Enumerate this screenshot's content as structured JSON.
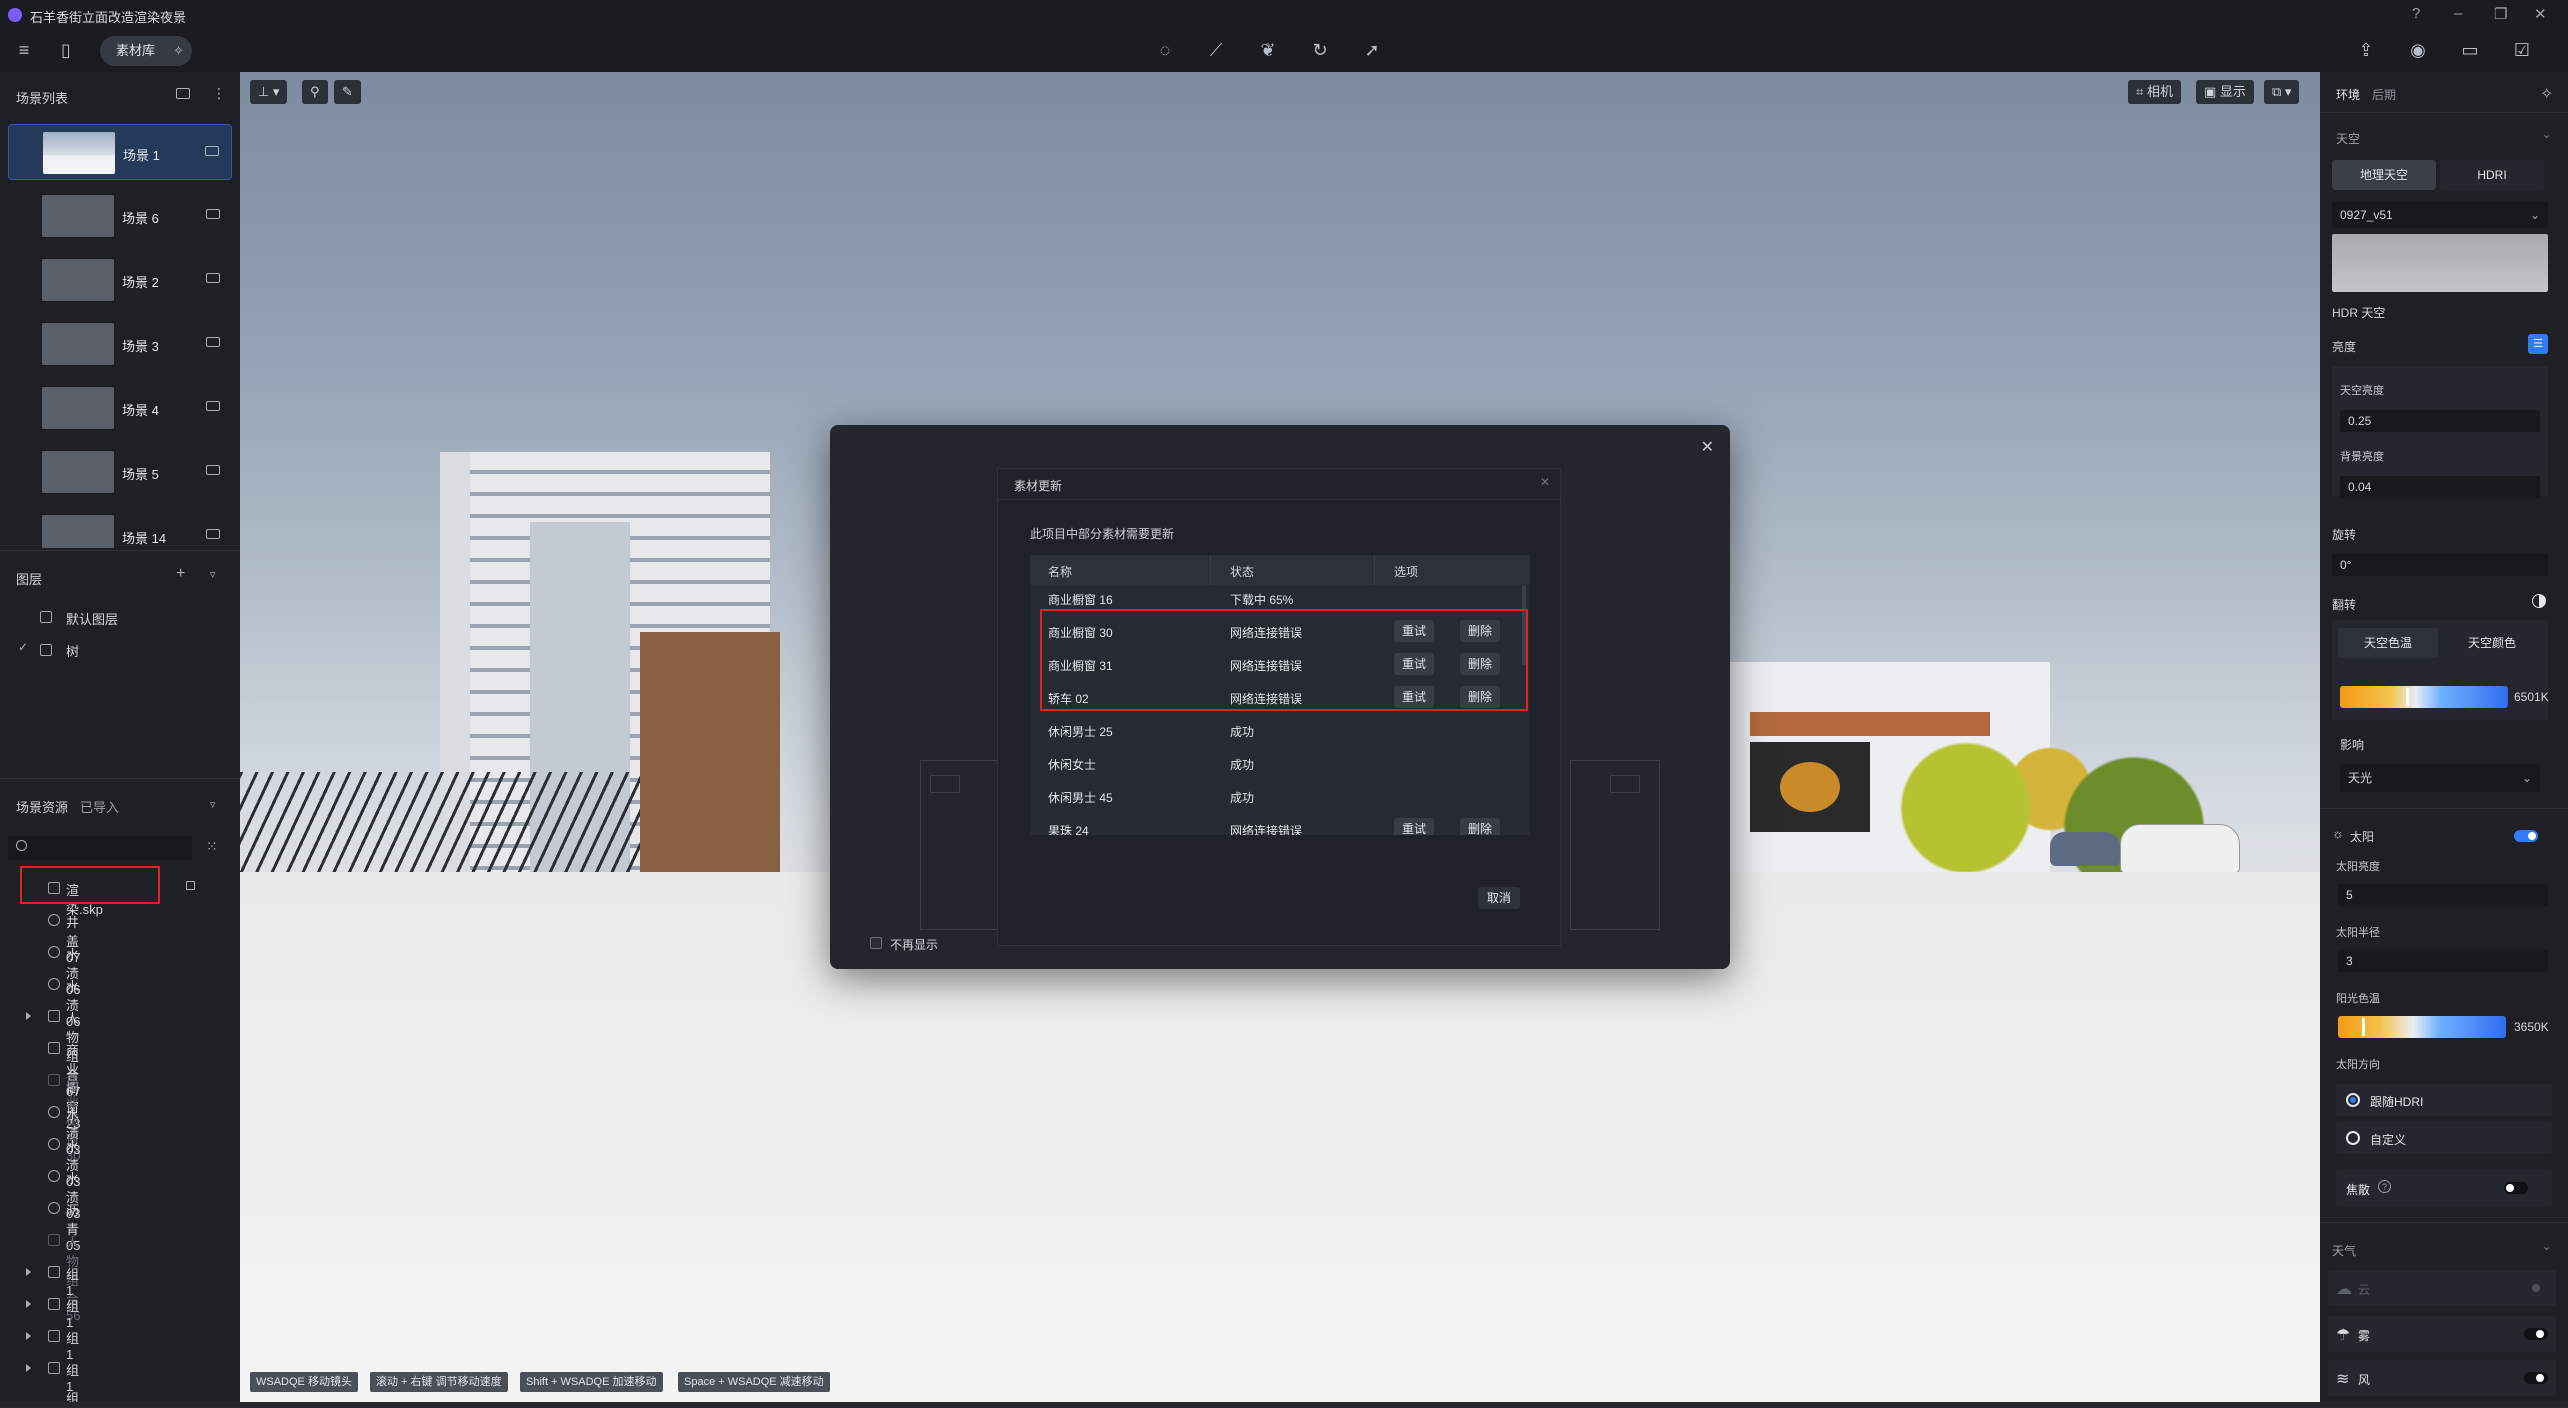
{
  "app": {
    "title": "石羊香街立面改造渲染夜景",
    "material_library": "素材库"
  },
  "left": {
    "scene_list_title": "场景列表",
    "scenes": [
      {
        "label": "场景 1"
      },
      {
        "label": "场景 6"
      },
      {
        "label": "场景 2"
      },
      {
        "label": "场景 3"
      },
      {
        "label": "场景 4"
      },
      {
        "label": "场景 5"
      },
      {
        "label": "场景 14"
      }
    ],
    "layers_title": "图层",
    "layers": [
      {
        "label": "默认图层"
      },
      {
        "label": "树"
      }
    ],
    "resources_tab": "场景资源",
    "imported_tab": "已导入",
    "resources": [
      {
        "label": "渲染.skp"
      },
      {
        "label": "井盖 07"
      },
      {
        "label": "水渍 06"
      },
      {
        "label": "水渍 06"
      },
      {
        "label": "人物组合 67"
      },
      {
        "label": "商业橱窗 23"
      },
      {
        "label": "商业橱窗 30"
      },
      {
        "label": "水渍 03"
      },
      {
        "label": "水渍 03"
      },
      {
        "label": "水渍 03"
      },
      {
        "label": "沥青 05"
      },
      {
        "label": "人物组合 56"
      },
      {
        "label": "组 1"
      },
      {
        "label": "组 1"
      },
      {
        "label": "组 1"
      },
      {
        "label": "组 1"
      },
      {
        "label": "组 1"
      }
    ]
  },
  "viewport": {
    "camera_btn": "相机",
    "display_btn": "显示",
    "hints": [
      {
        "key": "WSADQE",
        "desc": "移动镜头"
      },
      {
        "key": "滚动 + 右键",
        "desc": "调节移动速度"
      },
      {
        "key": "Shift + WSADQE",
        "desc": "加速移动"
      },
      {
        "key": "Space + WSADQE",
        "desc": "减速移动"
      }
    ]
  },
  "dialog": {
    "title": "素材更新",
    "subtitle": "此项目中部分素材需要更新",
    "columns": [
      "名称",
      "状态",
      "选项"
    ],
    "rows": [
      {
        "name": "商业橱窗 16",
        "status": "下载中 65%",
        "retry": "",
        "delete": ""
      },
      {
        "name": "商业橱窗 30",
        "status": "网络连接错误",
        "retry": "重试",
        "delete": "删除"
      },
      {
        "name": "商业橱窗 31",
        "status": "网络连接错误",
        "retry": "重试",
        "delete": "删除"
      },
      {
        "name": "轿车 02",
        "status": "网络连接错误",
        "retry": "重试",
        "delete": "删除"
      },
      {
        "name": "休闲男士 25",
        "status": "成功",
        "retry": "",
        "delete": ""
      },
      {
        "name": "休闲女士",
        "status": "成功",
        "retry": "",
        "delete": ""
      },
      {
        "name": "休闲男士 45",
        "status": "成功",
        "retry": "",
        "delete": ""
      },
      {
        "name": "果珠 24",
        "status": "网络连接错误",
        "retry": "重试",
        "delete": "删除"
      }
    ],
    "cancel": "取消",
    "dont_show": "不再显示"
  },
  "right": {
    "tabs": [
      "环境",
      "后期"
    ],
    "sky_title": "天空",
    "sky_modes": [
      "地理天空",
      "HDRI"
    ],
    "hdri_select": "0927_v51",
    "hdr_sky_label": "HDR 天空",
    "brightness_label": "亮度",
    "sky_brightness_label": "天空亮度",
    "sky_brightness": "0.25",
    "bg_brightness_label": "背景亮度",
    "bg_brightness": "0.04",
    "rotation_label": "旋转",
    "rotation": "0°",
    "flip_label": "翻转",
    "tint_modes": [
      "天空色温",
      "天空颜色"
    ],
    "sky_temp": "6501K",
    "influence_label": "影响",
    "influence_value": "天光",
    "sun_label": "太阳",
    "sun_brightness_label": "太阳亮度",
    "sun_brightness": "5",
    "sun_radius_label": "太阳半径",
    "sun_radius": "3",
    "sun_temp_label": "阳光色温",
    "sun_temp": "3650K",
    "sun_dir_label": "太阳方向",
    "sun_dir_opts": [
      "跟随HDRI",
      "自定义"
    ],
    "caustics_label": "焦散",
    "weather_title": "天气",
    "weather": [
      {
        "label": "云"
      },
      {
        "label": "雾"
      },
      {
        "label": "风"
      }
    ]
  },
  "colors": {
    "accent": "#2f7cf6",
    "highlight": "#e02424",
    "panel": "#1e2026"
  }
}
